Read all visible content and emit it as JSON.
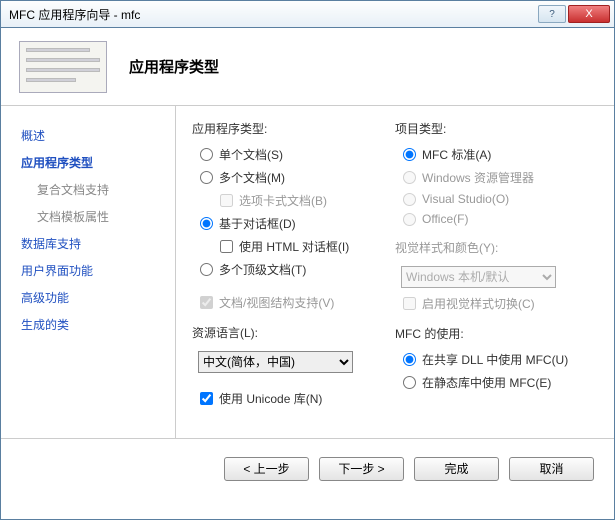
{
  "titlebar": {
    "text": "MFC 应用程序向导 - mfc",
    "help": "?",
    "close": "X"
  },
  "header": {
    "title": "应用程序类型"
  },
  "nav": {
    "items": [
      {
        "label": "概述",
        "sub": false,
        "active": false
      },
      {
        "label": "应用程序类型",
        "sub": false,
        "active": true
      },
      {
        "label": "复合文档支持",
        "sub": true,
        "active": false
      },
      {
        "label": "文档模板属性",
        "sub": true,
        "active": false
      },
      {
        "label": "数据库支持",
        "sub": false,
        "active": false
      },
      {
        "label": "用户界面功能",
        "sub": false,
        "active": false
      },
      {
        "label": "高级功能",
        "sub": false,
        "active": false
      },
      {
        "label": "生成的类",
        "sub": false,
        "active": false
      }
    ]
  },
  "appType": {
    "label": "应用程序类型:",
    "single": "单个文档(S)",
    "multi": "多个文档(M)",
    "tabbed": "选项卡式文档(B)",
    "dialog": "基于对话框(D)",
    "htmlDlg": "使用 HTML 对话框(I)",
    "multiTop": "多个顶级文档(T)",
    "docView": "文档/视图结构支持(V)"
  },
  "resLang": {
    "label": "资源语言(L):",
    "value": "中文(简体，中国)"
  },
  "unicode": {
    "label": "使用 Unicode 库(N)"
  },
  "projType": {
    "label": "项目类型:",
    "mfcStd": "MFC 标准(A)",
    "winExp": "Windows 资源管理器",
    "vs": "Visual Studio(O)",
    "office": "Office(F)"
  },
  "visual": {
    "label": "视觉样式和颜色(Y):",
    "value": "Windows 本机/默认",
    "enableSwitch": "启用视觉样式切换(C)"
  },
  "mfcUse": {
    "label": "MFC 的使用:",
    "shared": "在共享 DLL 中使用 MFC(U)",
    "static": "在静态库中使用 MFC(E)"
  },
  "footer": {
    "prev": "< 上一步",
    "next": "下一步 >",
    "finish": "完成",
    "cancel": "取消"
  }
}
